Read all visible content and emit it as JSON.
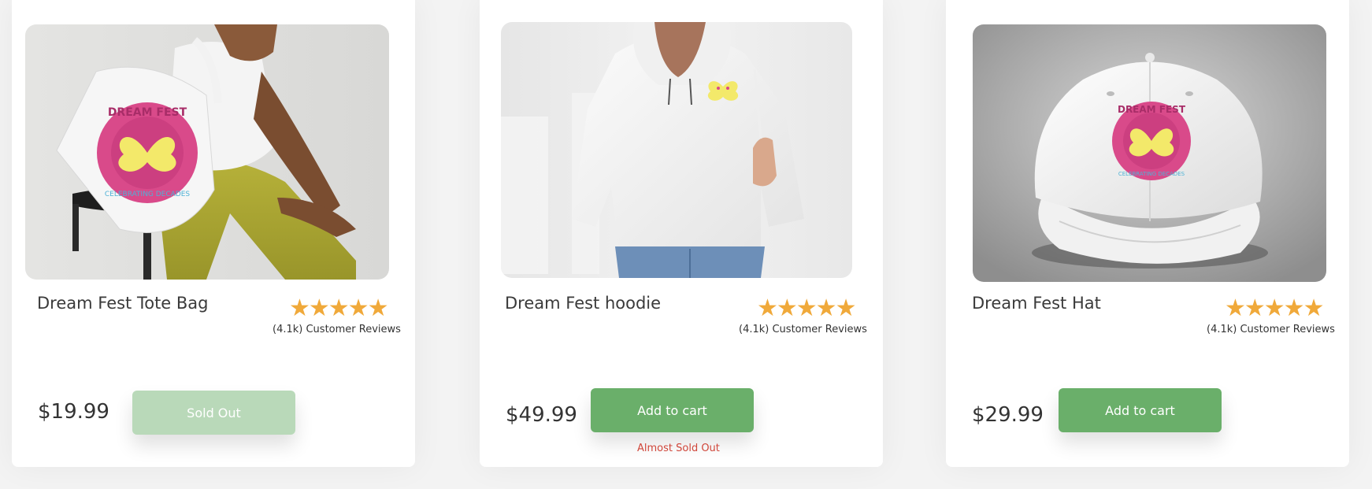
{
  "colors": {
    "accent_green": "#6aaf6a",
    "disabled_green": "#b9d9b9",
    "star": "#f0a93a",
    "warning_red": "#d0463a"
  },
  "products": [
    {
      "image_alt": "Model with Dream Fest tote bag",
      "title": "Dream Fest Tote Bag",
      "stars": "★★★★★",
      "reviews": "(4.1k) Customer Reviews",
      "price": "$19.99",
      "button_label": "Sold Out",
      "button_state": "disabled",
      "note": ""
    },
    {
      "image_alt": "Model wearing Dream Fest hoodie",
      "title": "Dream Fest hoodie",
      "stars": "★★★★★",
      "reviews": "(4.1k) Customer Reviews",
      "price": "$49.99",
      "button_label": "Add to cart",
      "button_state": "enabled",
      "note": "Almost Sold Out"
    },
    {
      "image_alt": "White Dream Fest baseball cap",
      "title": "Dream Fest Hat",
      "stars": "★★★★★",
      "reviews": "(4.1k) Customer Reviews",
      "price": "$29.99",
      "button_label": "Add to cart",
      "button_state": "enabled",
      "note": ""
    }
  ],
  "logo": {
    "top_text": "DREAM FEST",
    "bottom_text": "CELEBRATING DECADES",
    "icon": "butterfly-icon"
  }
}
